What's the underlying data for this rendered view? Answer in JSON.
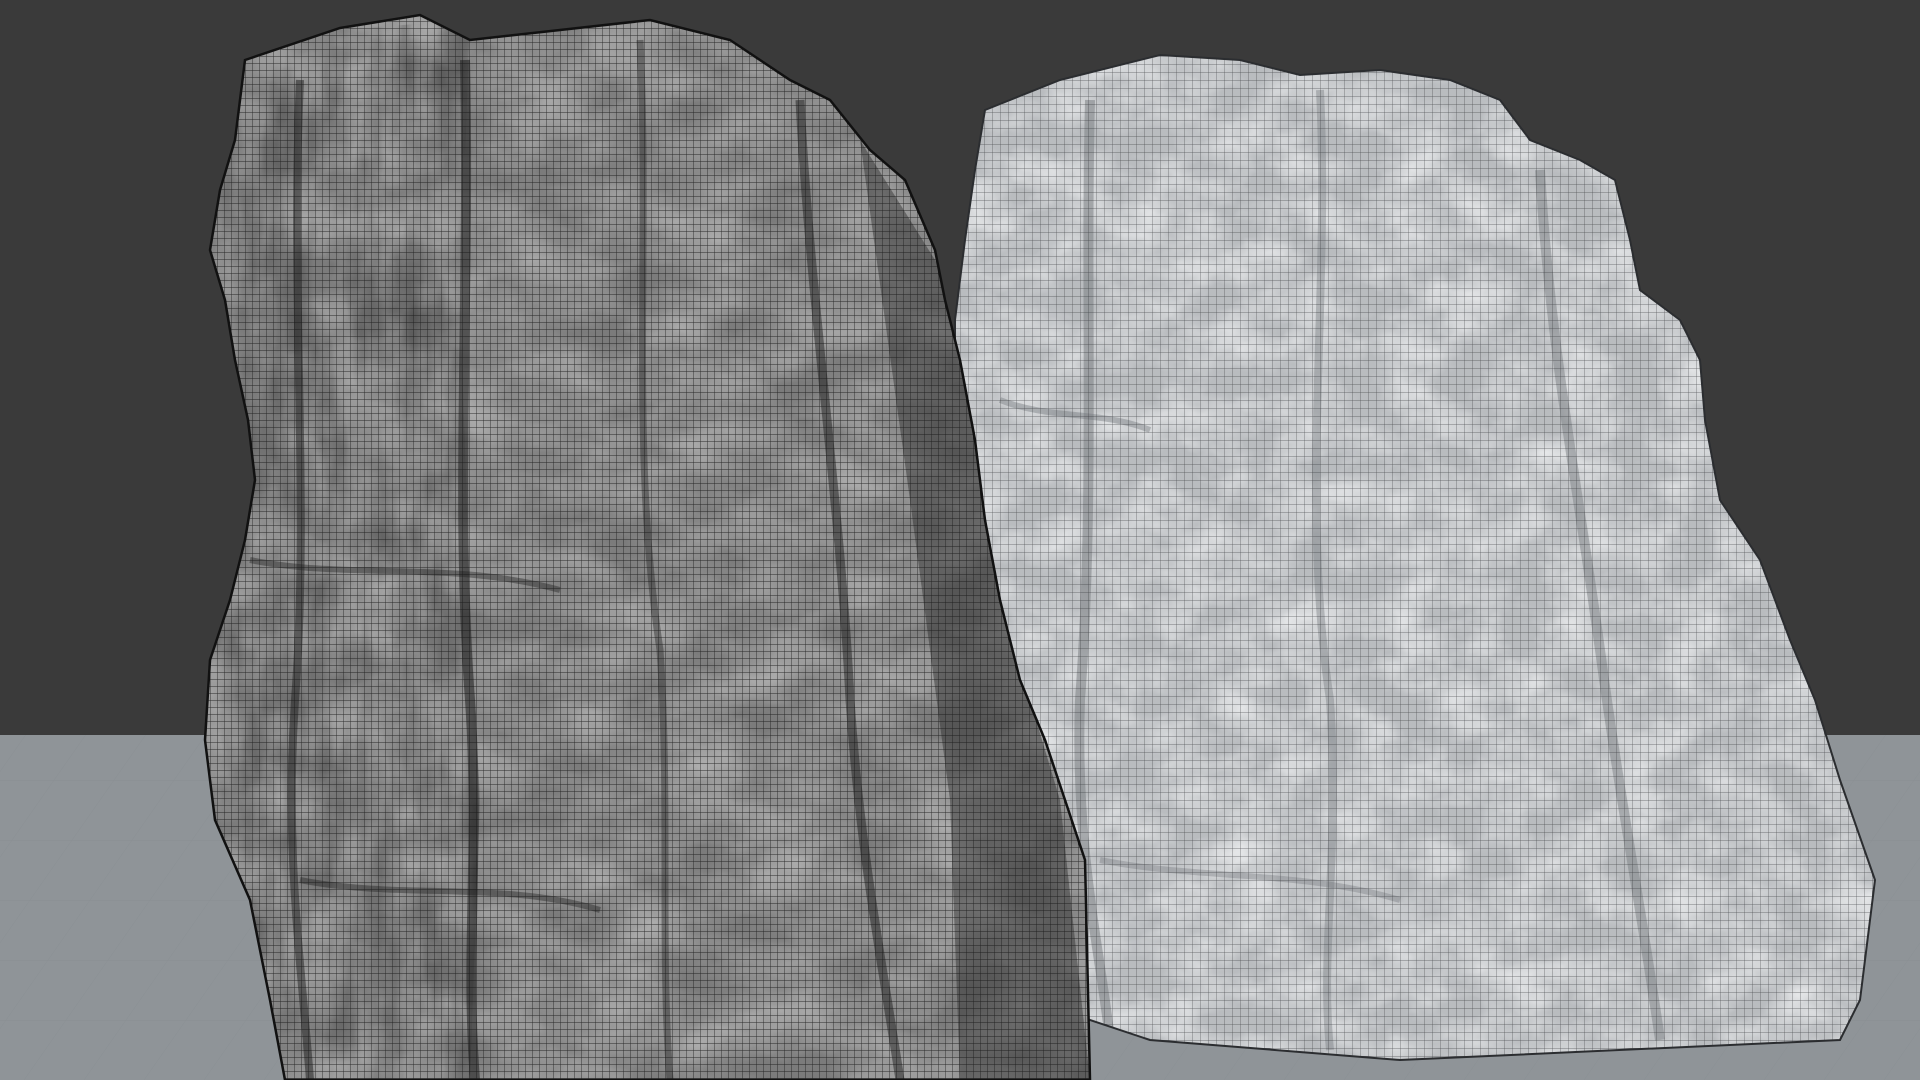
{
  "viewport": {
    "mode": "wireframe-overlay",
    "background_color": "#3a3a3a",
    "floor_color": "#8f9498",
    "floor_grid_color": "#7d8286"
  },
  "objects": [
    {
      "id": "rock-left",
      "shading": "dark",
      "base_color": "#7b7b7b",
      "shadow_color": "#2a2a2a",
      "wire_color": "#1a1a1a"
    },
    {
      "id": "rock-right",
      "shading": "light",
      "base_color": "#b9bcbf",
      "shadow_color": "#7c8084",
      "wire_color": "#2b2d30"
    }
  ]
}
